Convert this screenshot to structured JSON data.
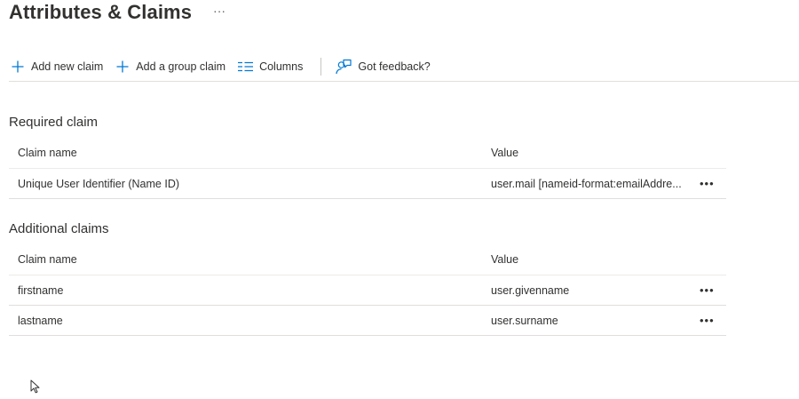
{
  "header": {
    "title": "Attributes & Claims",
    "more_label": "···"
  },
  "toolbar": {
    "add_new_claim": "Add new claim",
    "add_group_claim": "Add a group claim",
    "columns": "Columns",
    "feedback": "Got feedback?"
  },
  "required": {
    "section_title": "Required claim",
    "columns": [
      "Claim name",
      "Value"
    ],
    "rows": [
      {
        "name": "Unique User Identifier (Name ID)",
        "value": "user.mail [nameid-format:emailAddre...",
        "more": "•••"
      }
    ]
  },
  "additional": {
    "section_title": "Additional claims",
    "columns": [
      "Claim name",
      "Value"
    ],
    "rows": [
      {
        "name": "firstname",
        "value": "user.givenname",
        "more": "•••"
      },
      {
        "name": "lastname",
        "value": "user.surname",
        "more": "•••"
      }
    ]
  },
  "colors": {
    "accent": "#0078d4",
    "text": "#323130",
    "divider": "#e1dfdd"
  },
  "icons": [
    "plus-icon",
    "columns-icon",
    "feedback-icon",
    "mouse-cursor-icon"
  ]
}
